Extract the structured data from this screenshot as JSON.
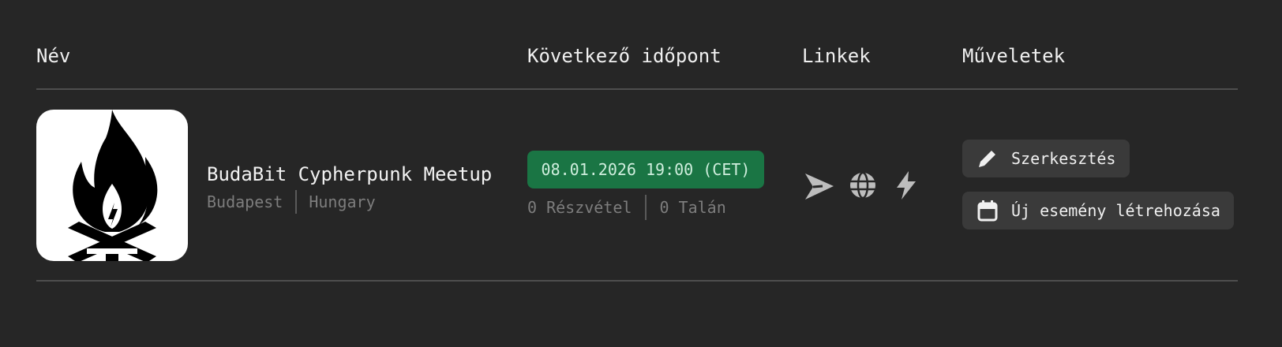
{
  "table": {
    "headers": {
      "name": "Név",
      "next_date": "Következő időpont",
      "links": "Linkek",
      "actions": "Műveletek"
    },
    "rows": [
      {
        "name": "BudaBit Cypherpunk Meetup",
        "city": "Budapest",
        "country": "Hungary",
        "next_date": "08.01.2026 19:00 (CET)",
        "attendance": "0 Részvétel",
        "maybe": "0 Talán",
        "links": [
          {
            "icon": "send-icon"
          },
          {
            "icon": "globe-icon"
          },
          {
            "icon": "lightning-icon"
          }
        ],
        "actions": {
          "edit_label": "Szerkesztés",
          "edit_icon": "pencil-icon",
          "new_event_label": "Új esemény létrehozása",
          "new_event_icon": "calendar-icon"
        }
      }
    ]
  },
  "colors": {
    "background": "#262626",
    "date_pill": "#1a7544",
    "button": "#3a3a3a",
    "muted_text": "#7d7d7d"
  }
}
